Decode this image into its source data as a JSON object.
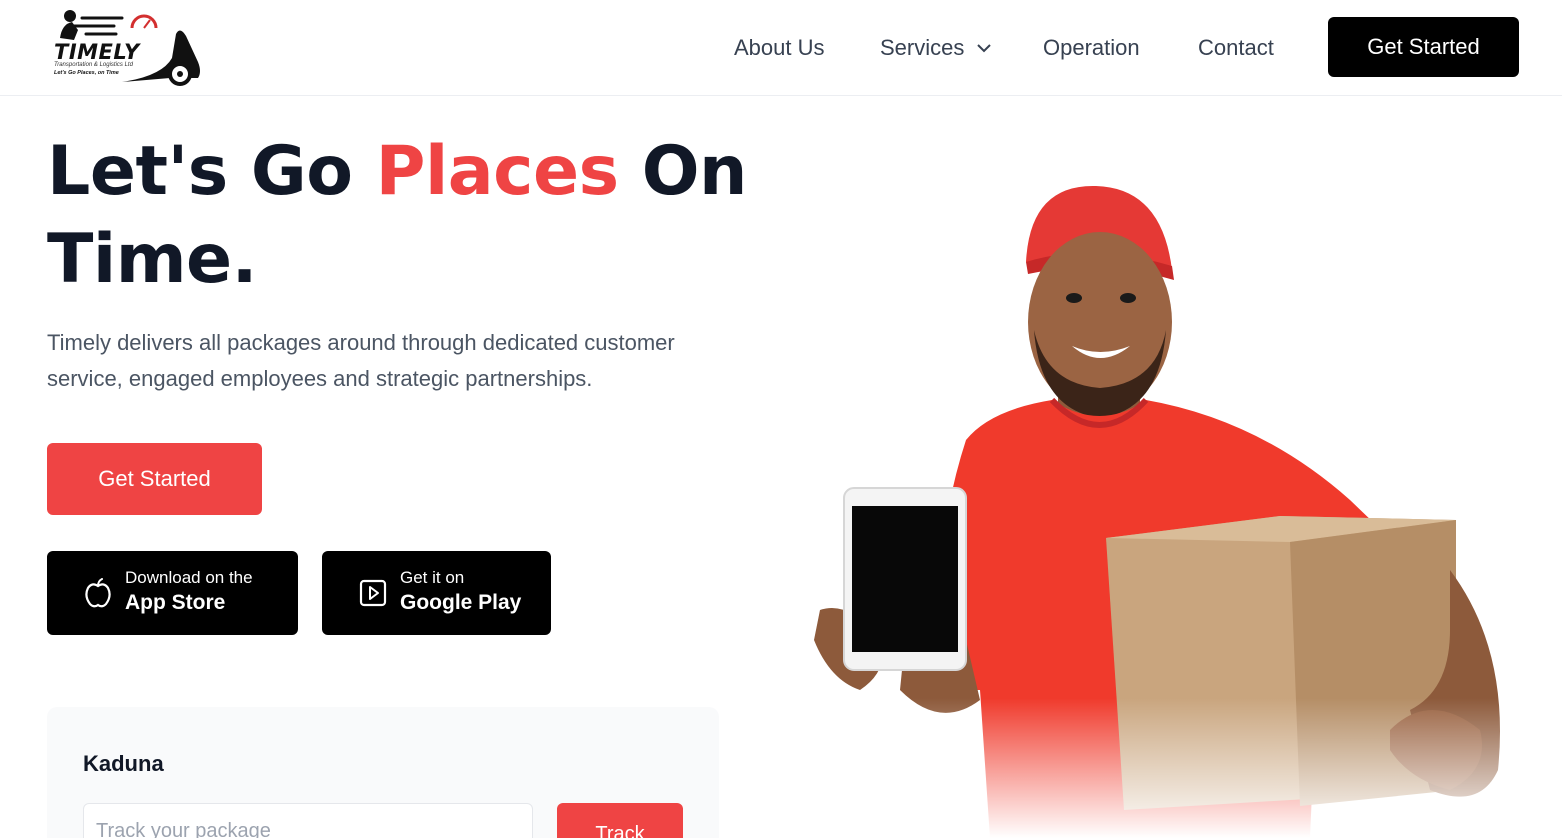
{
  "brand": {
    "name": "TIMELY",
    "subtitle": "Transportation & Logistics Ltd",
    "tagline": "Let's Go Places, on Time",
    "accent_color": "#ef4444",
    "dark_color": "#000000"
  },
  "nav": {
    "about": "About Us",
    "services": "Services",
    "operation": "Operation",
    "contact": "Contact",
    "cta": "Get Started"
  },
  "hero": {
    "title_part1": "Let's Go ",
    "title_accent": "Places",
    "title_part2": " On Time.",
    "description": "Timely delivers all packages around through dedicated customer service, engaged employees and strategic partnerships.",
    "primary_cta": "Get Started"
  },
  "stores": {
    "apple_small": "Download on the",
    "apple_big": "App Store",
    "apple_icon": "apple-icon",
    "google_small": "Get it on",
    "google_big": "Google Play",
    "google_icon": "play-icon"
  },
  "tracking": {
    "city": "Kaduna",
    "placeholder": "Track your package",
    "button": "Track"
  }
}
